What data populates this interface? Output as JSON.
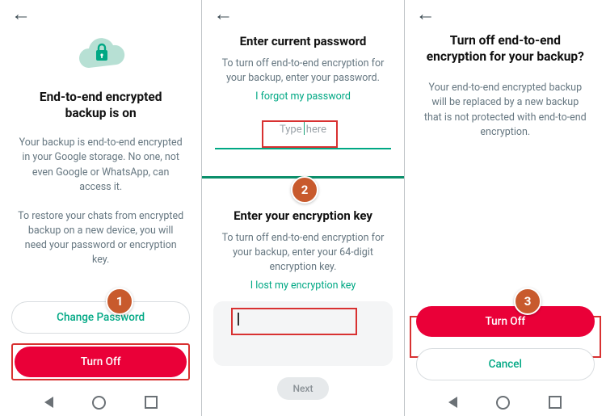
{
  "panel1": {
    "title": "End-to-end encrypted backup is on",
    "desc1": "Your backup is end-to-end encrypted in your Google storage. No one, not even Google or WhatsApp, can access it.",
    "desc2": "To restore your chats from encrypted backup on a new device, you will need your password or encryption key.",
    "change_password": "Change Password",
    "turn_off": "Turn Off"
  },
  "panel2_password": {
    "title": "Enter current password",
    "desc": "To turn off end-to-end encryption for your backup, enter your password.",
    "forgot": "I forgot my password",
    "placeholder_left": "Type",
    "placeholder_right": "here"
  },
  "panel2_key": {
    "title": "Enter your encryption key",
    "desc": "To turn off end-to-end encryption for your backup, enter your 64-digit encryption key.",
    "lost": "I lost my encryption key",
    "next": "Next"
  },
  "panel3": {
    "title": "Turn off end-to-end encryption for your backup?",
    "desc": "Your end-to-end encrypted backup will be replaced by a new backup that is not protected with end-to-end encryption.",
    "turn_off": "Turn Off",
    "cancel": "Cancel"
  },
  "steps": {
    "one": "1",
    "two": "2",
    "three": "3"
  }
}
